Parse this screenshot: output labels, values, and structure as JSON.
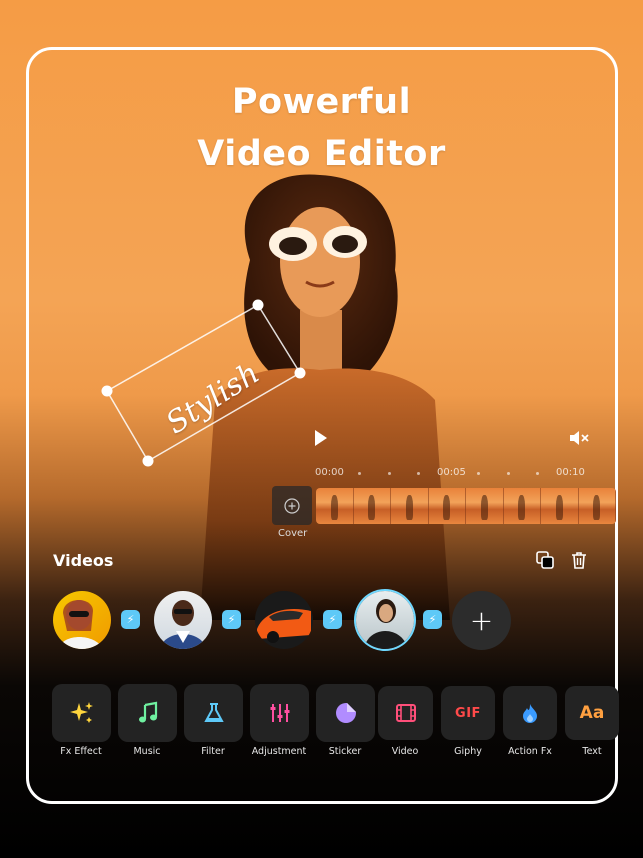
{
  "hero": {
    "line1": "Powerful",
    "line2": "Video Editor"
  },
  "sticker": {
    "text": "Stylish"
  },
  "timeline": {
    "times": [
      "00:00",
      "00:05",
      "00:10"
    ],
    "cover_label": "Cover"
  },
  "videos": {
    "title": "Videos",
    "items": [
      {
        "name": "video-1",
        "selected": false
      },
      {
        "name": "video-2",
        "selected": false
      },
      {
        "name": "video-3",
        "selected": false
      },
      {
        "name": "video-4",
        "selected": true
      }
    ]
  },
  "tools": [
    {
      "label": "Fx Effect",
      "icon": "sparkle-icon",
      "color": "#ffd53d"
    },
    {
      "label": "Music",
      "icon": "music-note-icon",
      "color": "#6ff0a0"
    },
    {
      "label": "Filter",
      "icon": "flask-icon",
      "color": "#5ec9f7"
    },
    {
      "label": "Adjustment",
      "icon": "sliders-icon",
      "color": "#ff4fa0"
    },
    {
      "label": "Sticker",
      "icon": "sticker-icon",
      "color": "#b18cff"
    },
    {
      "label": "Video",
      "icon": "film-icon",
      "color": "#ff4f7a"
    },
    {
      "label": "Giphy",
      "icon": "gif-icon",
      "color": "#ff4a4a",
      "glyph": "GIF"
    },
    {
      "label": "Action Fx",
      "icon": "flame-icon",
      "color": "#3a9bff"
    },
    {
      "label": "Text",
      "icon": "text-icon",
      "color": "#ffa040",
      "glyph": "Aa"
    }
  ],
  "colors": {
    "accent": "#5ec9f7",
    "background_top": "#f59c45",
    "background_bottom": "#000000"
  }
}
